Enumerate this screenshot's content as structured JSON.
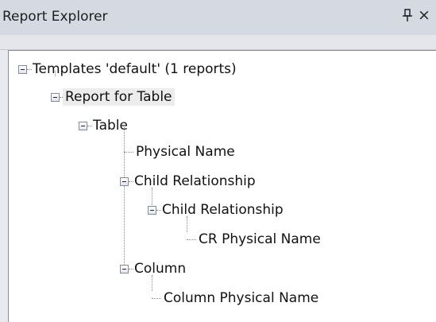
{
  "window": {
    "title": "Report Explorer",
    "pin_icon": "pin-icon",
    "close_icon": "close-icon",
    "close_glyph": "×"
  },
  "tree": {
    "root": {
      "label": "Templates 'default' (1 reports)",
      "expanded": true
    },
    "report": {
      "label": "Report for Table",
      "expanded": true,
      "selected": true
    },
    "table": {
      "label": "Table",
      "expanded": true
    },
    "physical_name": {
      "label": "Physical Name"
    },
    "child_relationship": {
      "label": "Child Relationship",
      "expanded": true
    },
    "child_relationship_inner": {
      "label": "Child Relationship",
      "expanded": true
    },
    "cr_physical_name": {
      "label": "CR Physical Name"
    },
    "column": {
      "label": "Column",
      "expanded": true
    },
    "column_physical_name": {
      "label": "Column Physical Name"
    }
  }
}
